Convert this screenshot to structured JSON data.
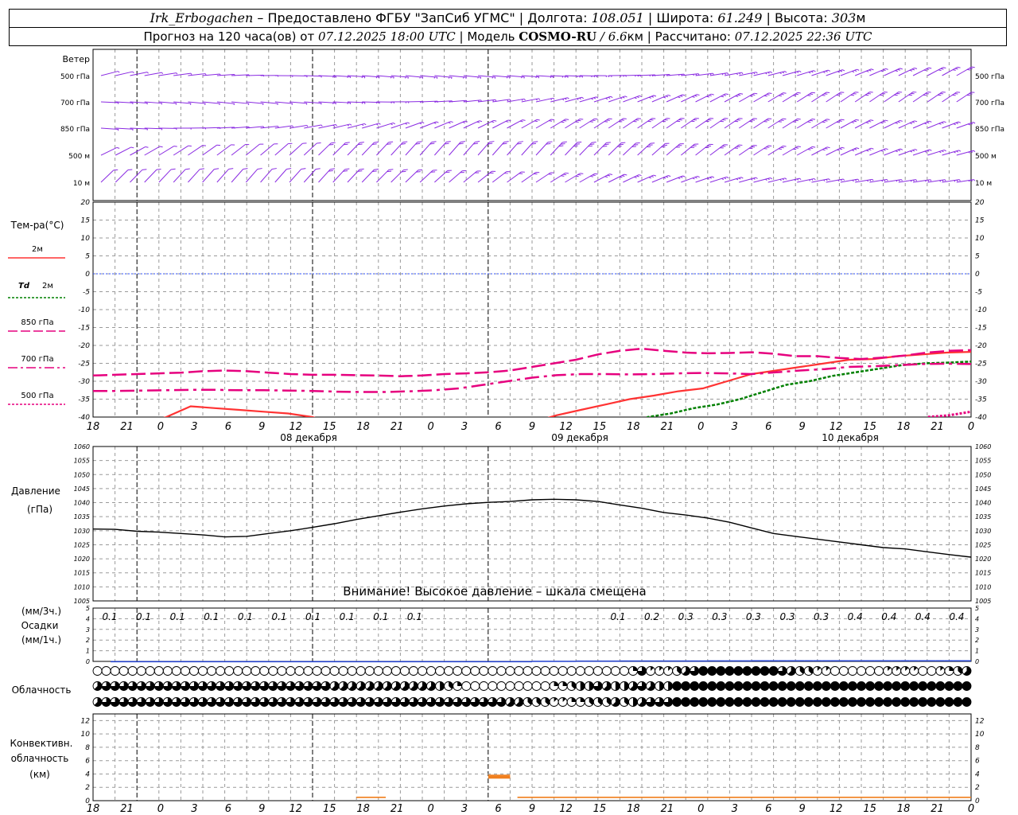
{
  "header": {
    "station": "Irk_Erbogachen",
    "provider": "– Предоставлено ФГБУ \"ЗапСиб УГМС\" |",
    "lon_label": "Долгота:",
    "lon_value": "108.051",
    "lat_label": "| Широта:",
    "lat_value": "61.249",
    "alt_label": "| Высота:",
    "alt_value": "303",
    "alt_unit": "м",
    "forecast_prefix": "Прогноз на 120 часа(ов) от",
    "forecast_time": "07.12.2025 18:00 UTC",
    "model_label": "| Модель",
    "model_name": "COSMO-RU",
    "model_res": "/ 6.6",
    "model_unit": "км",
    "calc_label": "| Рассчитано:",
    "calc_time": "07.12.2025 22:36 UTC"
  },
  "time_axis": {
    "hour_labels": [
      "18",
      "21",
      "0",
      "3",
      "6",
      "9",
      "12",
      "15",
      "18",
      "21",
      "0",
      "3",
      "6",
      "9",
      "12",
      "15",
      "18",
      "21",
      "0",
      "3",
      "6",
      "9",
      "12",
      "15",
      "18",
      "21",
      "0"
    ],
    "day_labels": [
      "08 декабря",
      "09 декабря",
      "10 декабря"
    ]
  },
  "wind_panel": {
    "title": "Ветер",
    "levels": [
      "500 гПа",
      "700 гПа",
      "850 гПа",
      "500 м",
      "10 м"
    ],
    "barb_color": "#8a2be2"
  },
  "colors": {
    "t2m": "#ff3333",
    "td2m": "#008000",
    "t850": "#e6007e",
    "t700": "#e6007e",
    "t500": "#e6007e",
    "pressure": "#000000",
    "precip": "#1f3fd1",
    "convective": "#f08020",
    "grid": "#999999",
    "zero_line": "#3050ff"
  },
  "legend": {
    "temp_title": "Тем-ра(°С)",
    "t2m": "2м",
    "td_sym": "Td",
    "td_lvl": "2м",
    "t850": "850 гПа",
    "t700": "700 гПа",
    "t500": "500 гПа"
  },
  "pressure_panel": {
    "title": "Давление",
    "unit": "(гПа)",
    "warning": "Внимание! Высокое давление – шкала смещена"
  },
  "precip_panel": {
    "unit3": "(мм/3ч.)",
    "title": "Осадки",
    "unit1": "(мм/1ч.)",
    "labels": [
      "0.1",
      "0.1",
      "0.1",
      "0.1",
      "0.1",
      "0.1",
      "0.1",
      "0.1",
      "0.1",
      "0.1",
      "",
      "",
      "",
      "",
      "",
      "0.1",
      "0.2",
      "0.3",
      "0.3",
      "0.3",
      "0.3",
      "0.3",
      "0.4",
      "0.4",
      "0.4",
      "0.4"
    ]
  },
  "cloud_panel": {
    "title": "Облачность",
    "row1": [
      0,
      0,
      0,
      0,
      0,
      0,
      0,
      0,
      0,
      0,
      0,
      0,
      0,
      0,
      0,
      0,
      0,
      0,
      0,
      0,
      0,
      0,
      0,
      0,
      0,
      0,
      0,
      0,
      0,
      0,
      0,
      0,
      0,
      0,
      0,
      0,
      0,
      0,
      0,
      0,
      0,
      0,
      0,
      0,
      0,
      0,
      0,
      0,
      0,
      0,
      0,
      0,
      0,
      0,
      0,
      0,
      0,
      0,
      0,
      0,
      0,
      2,
      6,
      1,
      1,
      1,
      3,
      5,
      6,
      8,
      8,
      8,
      8,
      8,
      8,
      8,
      8,
      8,
      6,
      5,
      3,
      3,
      1,
      1,
      0,
      0,
      0,
      0,
      0,
      0,
      1,
      1,
      1,
      1,
      0,
      0,
      1,
      2,
      3,
      5
    ],
    "row2": [
      5,
      6,
      6,
      6,
      6,
      6,
      6,
      6,
      6,
      6,
      6,
      6,
      6,
      6,
      6,
      6,
      6,
      6,
      6,
      6,
      6,
      6,
      6,
      6,
      6,
      6,
      6,
      5,
      5,
      5,
      5,
      5,
      5,
      5,
      5,
      5,
      5,
      5,
      5,
      4,
      3,
      2,
      0,
      0,
      0,
      0,
      0,
      0,
      0,
      0,
      0,
      0,
      2,
      2,
      3,
      4,
      4,
      6,
      5,
      4,
      4,
      5,
      6,
      5,
      4,
      4,
      8,
      8,
      8,
      8,
      8,
      8,
      8,
      8,
      8,
      8,
      8,
      8,
      8,
      8,
      8,
      8,
      8,
      8,
      8,
      8,
      8,
      8,
      8,
      8,
      8,
      8,
      8,
      8,
      8,
      8,
      8,
      8,
      8,
      8
    ],
    "row3": [
      5,
      6,
      6,
      6,
      6,
      6,
      6,
      6,
      6,
      6,
      6,
      6,
      6,
      6,
      6,
      6,
      6,
      6,
      6,
      6,
      6,
      6,
      6,
      6,
      6,
      6,
      6,
      6,
      6,
      6,
      6,
      6,
      6,
      6,
      6,
      6,
      6,
      6,
      6,
      6,
      6,
      6,
      6,
      6,
      6,
      6,
      6,
      5,
      5,
      3,
      3,
      3,
      1,
      1,
      2,
      2,
      3,
      3,
      3,
      5,
      3,
      4,
      5,
      6,
      6,
      6,
      8,
      8,
      8,
      8,
      8,
      8,
      8,
      8,
      8,
      8,
      8,
      8,
      8,
      8,
      8,
      8,
      8,
      8,
      8,
      8,
      8,
      8,
      8,
      8,
      8,
      8,
      8,
      8,
      8,
      8,
      8,
      8,
      8,
      8
    ]
  },
  "conv_panel": {
    "title1": "Конвективн.",
    "title2": "облачность",
    "unit": "(км)"
  },
  "chart_data": [
    {
      "type": "line",
      "title": "Тем-ра(°С)",
      "ylim": [
        -40,
        20
      ],
      "yticks": [
        20,
        15,
        10,
        5,
        0,
        -5,
        -10,
        -15,
        -20,
        -25,
        -30,
        -35,
        -40
      ],
      "x": [
        0,
        3,
        6,
        9,
        12,
        15,
        18,
        21,
        24,
        27,
        30,
        33,
        36,
        39,
        42,
        45,
        48,
        51,
        54,
        57,
        60,
        63,
        66,
        69,
        72,
        75,
        78,
        81,
        84,
        87,
        90,
        93,
        96,
        99,
        102,
        105,
        108,
        111,
        114,
        117,
        120
      ],
      "series": [
        {
          "name": "2м",
          "values": [
            -45,
            -45,
            -42,
            -40,
            -37,
            -37.5,
            -38,
            -38.5,
            -39,
            -40,
            -42,
            -44,
            -46,
            -46,
            -46,
            -45,
            -44,
            -43,
            -41.5,
            -39.5,
            -38,
            -36.5,
            -35,
            -34,
            -32.8,
            -32,
            -30,
            -28,
            -27,
            -26,
            -25,
            -24,
            -23.8,
            -23,
            -22.5,
            -22,
            -21.8
          ]
        },
        {
          "name": "Td 2м",
          "values": [
            -50,
            -50,
            -50,
            -50,
            -50,
            -50,
            -50,
            -50,
            -50,
            -50,
            -50,
            -50,
            -50,
            -50,
            -50,
            -50,
            -50,
            -50,
            -50,
            -50,
            -50,
            -50,
            -50,
            -50,
            -40,
            -39,
            -37.5,
            -36.5,
            -35,
            -33,
            -31,
            -30,
            -28.5,
            -27.5,
            -26.5,
            -25.5,
            -25,
            -24.8,
            -24.5
          ]
        },
        {
          "name": "850 гПа",
          "values": [
            -28.4,
            -28.2,
            -28,
            -27.8,
            -27.6,
            -27.2,
            -27,
            -27.2,
            -27.6,
            -28,
            -28.2,
            -28.2,
            -28.3,
            -28.4,
            -28.6,
            -28.4,
            -28,
            -27.8,
            -27.5,
            -27,
            -26,
            -25,
            -24,
            -22.5,
            -21.5,
            -20.9,
            -21.5,
            -22,
            -22.2,
            -22.1,
            -21.9,
            -22.3,
            -23,
            -23,
            -23.5,
            -23.8,
            -23.4,
            -22.8,
            -22,
            -21.5,
            -21.3
          ]
        },
        {
          "name": "700 гПа",
          "values": [
            -32.7,
            -32.7,
            -32.6,
            -32.5,
            -32.4,
            -32.4,
            -32.5,
            -32.5,
            -32.6,
            -32.7,
            -32.9,
            -33,
            -33,
            -32.8,
            -32.5,
            -32,
            -31,
            -30,
            -29,
            -28.3,
            -28,
            -28,
            -28.1,
            -28,
            -27.8,
            -27.7,
            -27.8,
            -28,
            -27.5,
            -27,
            -26.6,
            -26,
            -25.8,
            -25.5,
            -25.2,
            -25.1,
            -25.2
          ]
        },
        {
          "name": "500 гПа",
          "values": [
            -50,
            -50,
            -50,
            -50,
            -50,
            -50,
            -50,
            -50,
            -50,
            -50,
            -50,
            -50,
            -50,
            -50,
            -50,
            -50,
            -50,
            -50,
            -50,
            -50,
            -50,
            -50,
            -50,
            -50,
            -50,
            -50,
            -50,
            -50,
            -50,
            -50,
            -50,
            -50,
            -50,
            -50,
            -50,
            -50,
            -50,
            -50,
            -40,
            -39.5,
            -38.5
          ]
        }
      ]
    },
    {
      "type": "line",
      "title": "Давление",
      "ylabel": "(гПа)",
      "ylim": [
        1005,
        1060
      ],
      "yticks": [
        1060,
        1055,
        1050,
        1045,
        1040,
        1035,
        1030,
        1025,
        1020,
        1015,
        1010,
        1005
      ],
      "x": [
        0,
        3,
        6,
        9,
        12,
        15,
        18,
        21,
        24,
        27,
        30,
        33,
        36,
        39,
        42,
        45,
        48,
        51,
        54,
        57,
        60,
        63,
        66,
        69,
        72,
        75,
        78,
        81,
        84,
        87,
        90,
        93,
        96,
        99,
        102,
        105,
        108,
        111,
        114,
        117,
        120
      ],
      "series": [
        {
          "name": "",
          "values": [
            1030.6,
            1030.5,
            1029.8,
            1029.5,
            1029,
            1028.5,
            1027.8,
            1028,
            1029,
            1030,
            1031.2,
            1032.5,
            1034,
            1035.3,
            1036.6,
            1037.8,
            1038.8,
            1039.6,
            1040.1,
            1040.4,
            1041,
            1041.2,
            1041,
            1040.4,
            1039.2,
            1038,
            1036.5,
            1035.6,
            1034.5,
            1033,
            1031,
            1029,
            1028,
            1027,
            1026,
            1025,
            1024,
            1023.5,
            1022.5,
            1021.5,
            1020.6
          ]
        }
      ]
    },
    {
      "type": "bar",
      "title": "Осадки",
      "ylabel": "(мм/1ч.)",
      "ylim": [
        0,
        5
      ],
      "yticks": [
        5,
        4,
        3,
        2,
        1,
        0
      ],
      "x_step_hours": 3,
      "values": [
        0,
        0,
        0.03,
        0.03,
        0.03,
        0.03,
        0.03,
        0.03,
        0.03,
        0.03,
        0.03,
        0.03,
        0.03,
        0.03,
        0.03,
        0.03,
        0.03,
        0.03,
        0.03,
        0.03,
        0.03,
        0.03,
        0.03,
        0.03,
        0.03,
        0.03,
        0.03,
        0.03,
        0.03,
        0.03,
        0.03,
        0.03,
        0.03,
        0.03,
        0.03,
        0.03,
        0.03,
        0.03,
        0.03,
        0.03,
        0.03,
        0.03,
        0.03,
        0.03,
        0.03,
        0.03,
        0.03,
        0.03,
        0.03,
        0.03,
        0.06,
        0.06,
        0.06,
        0.06,
        0.06,
        0.08,
        0.08,
        0.08,
        0.08,
        0.08,
        0.09,
        0.09,
        0.09,
        0.09,
        0.09,
        0.09,
        0.09,
        0.09,
        0.09,
        0.09,
        0.1,
        0.1,
        0.1,
        0.1,
        0.1,
        0.11,
        0.11,
        0.11,
        0.11,
        0.11,
        0.11,
        0.11,
        0.11,
        0.11,
        0.11,
        0.11,
        0.11,
        0.11,
        0.11,
        0.11,
        0.11,
        0.11,
        0.11,
        0.11,
        0.11,
        0.11,
        0.11,
        0.11,
        0.11,
        0.11
      ]
    },
    {
      "type": "bar",
      "title": "Конвективн. облачность",
      "ylabel": "(км)",
      "ylim": [
        0,
        13
      ],
      "yticks": [
        12,
        10,
        8,
        6,
        4,
        2,
        0
      ],
      "segments": [
        {
          "from": 36,
          "to": 40,
          "bottom": 0.4,
          "top": 0.6
        },
        {
          "from": 54,
          "to": 57,
          "bottom": 3.3,
          "top": 3.9
        },
        {
          "from": 58,
          "to": 120,
          "bottom": 0.4,
          "top": 0.6
        }
      ]
    }
  ]
}
